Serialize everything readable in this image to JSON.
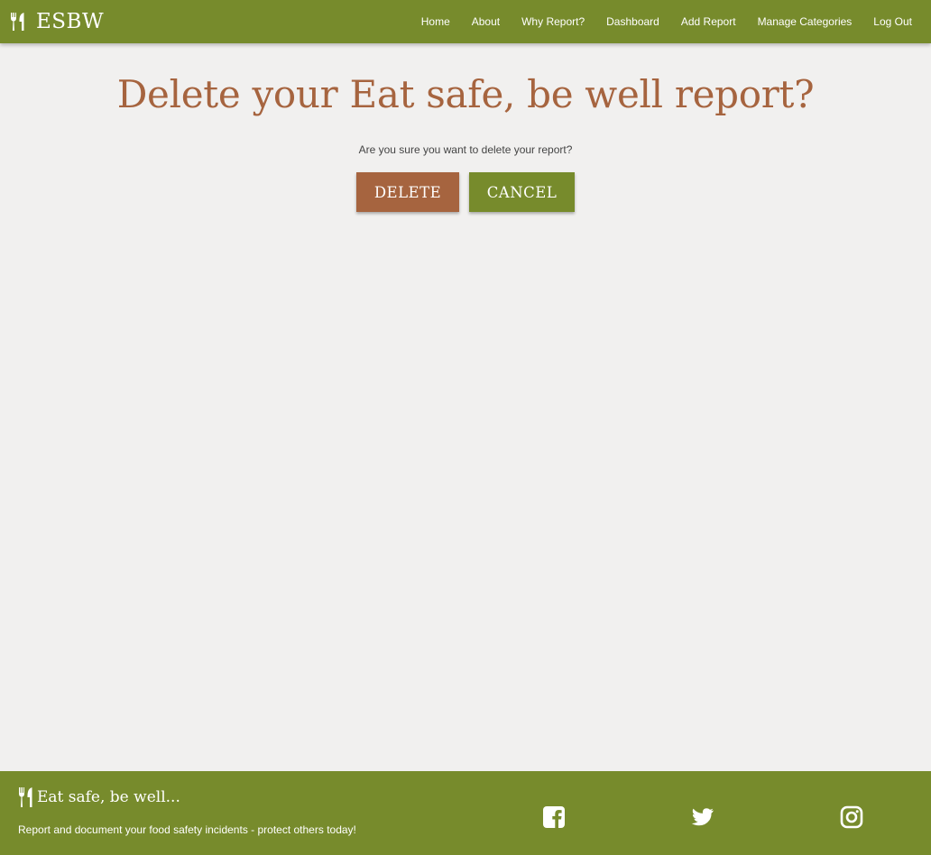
{
  "navbar": {
    "brand": "ESBW",
    "brand_icon": "utensils-icon",
    "links": [
      "Home",
      "About",
      "Why Report?",
      "Dashboard",
      "Add Report",
      "Manage Categories",
      "Log Out"
    ]
  },
  "main": {
    "title": "Delete your Eat safe, be well report?",
    "subtitle": "Are you sure you want to delete your report?",
    "delete_label": "DELETE",
    "cancel_label": "CANCEL"
  },
  "footer": {
    "brand": "Eat safe, be well...",
    "tagline": "Report and document your food safety incidents - protect others today!",
    "social": [
      "facebook-icon",
      "twitter-icon",
      "instagram-icon"
    ]
  },
  "colors": {
    "primary_green": "#778b2c",
    "accent_brown": "#a6643f",
    "background": "#f1f0ef"
  }
}
